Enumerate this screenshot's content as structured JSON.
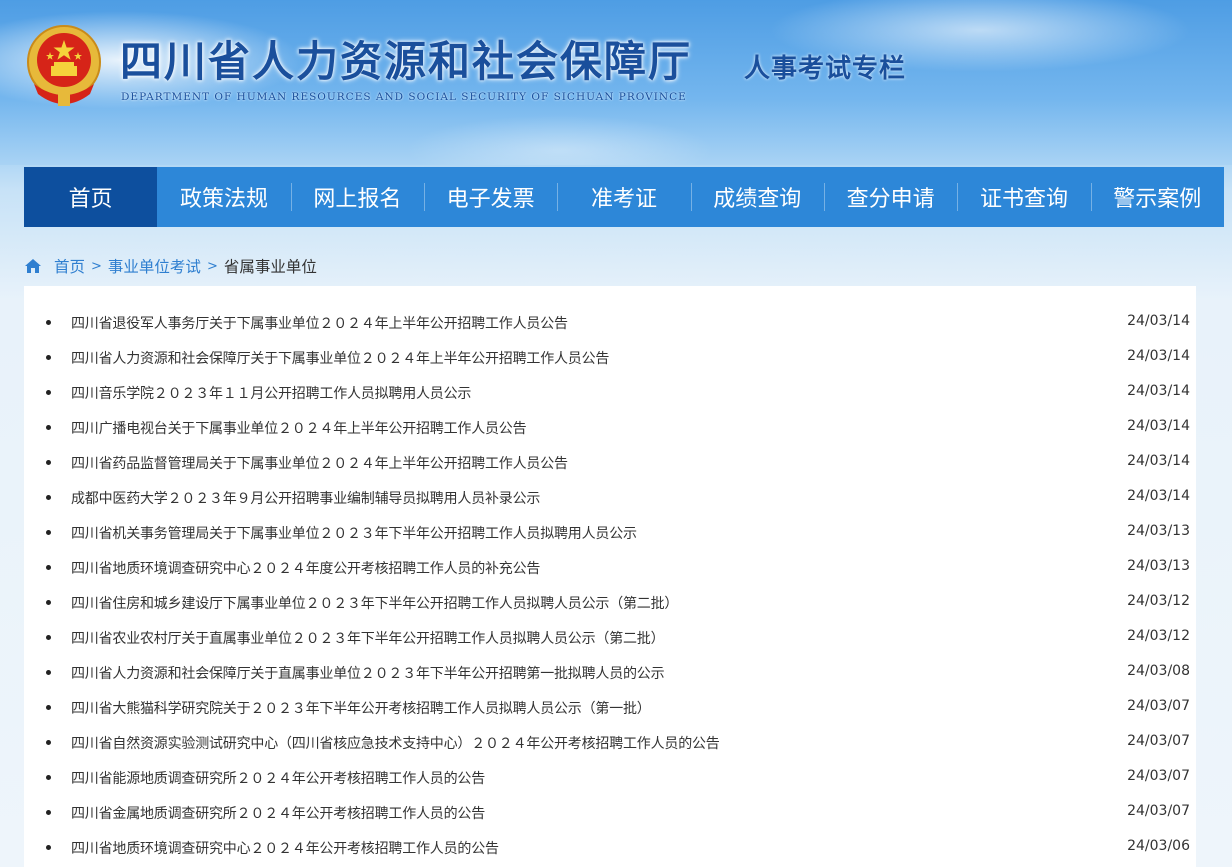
{
  "header": {
    "title": "四川省人力资源和社会保障厅",
    "subtitle": "DEPARTMENT OF HUMAN RESOURCES AND SOCIAL SECURITY OF SICHUAN PROVINCE",
    "column": "人事考试专栏",
    "emblem_icon": "national-emblem-icon"
  },
  "nav": {
    "items": [
      {
        "label": "首页",
        "active": true
      },
      {
        "label": "政策法规"
      },
      {
        "label": "网上报名"
      },
      {
        "label": "电子发票"
      },
      {
        "label": "准考证"
      },
      {
        "label": "成绩查询"
      },
      {
        "label": "查分申请"
      },
      {
        "label": "证书查询"
      },
      {
        "label": "警示案例"
      }
    ]
  },
  "breadcrumb": {
    "home": "首页",
    "level1": "事业单位考试",
    "current": "省属事业单位",
    "separator": ">"
  },
  "list": [
    {
      "title": "四川省退役军人事务厅关于下属事业单位２０２４年上半年公开招聘工作人员公告",
      "date": "24/03/14"
    },
    {
      "title": "四川省人力资源和社会保障厅关于下属事业单位２０２４年上半年公开招聘工作人员公告",
      "date": "24/03/14"
    },
    {
      "title": "四川音乐学院２０２３年１１月公开招聘工作人员拟聘用人员公示",
      "date": "24/03/14"
    },
    {
      "title": "四川广播电视台关于下属事业单位２０２４年上半年公开招聘工作人员公告",
      "date": "24/03/14"
    },
    {
      "title": "四川省药品监督管理局关于下属事业单位２０２４年上半年公开招聘工作人员公告",
      "date": "24/03/14"
    },
    {
      "title": "成都中医药大学２０２３年９月公开招聘事业编制辅导员拟聘用人员补录公示",
      "date": "24/03/14"
    },
    {
      "title": "四川省机关事务管理局关于下属事业单位２０２３年下半年公开招聘工作人员拟聘用人员公示",
      "date": "24/03/13"
    },
    {
      "title": "四川省地质环境调查研究中心２０２４年度公开考核招聘工作人员的补充公告",
      "date": "24/03/13"
    },
    {
      "title": "四川省住房和城乡建设厅下属事业单位２０２３年下半年公开招聘工作人员拟聘人员公示（第二批）",
      "date": "24/03/12"
    },
    {
      "title": "四川省农业农村厅关于直属事业单位２０２３年下半年公开招聘工作人员拟聘人员公示（第二批）",
      "date": "24/03/12"
    },
    {
      "title": "四川省人力资源和社会保障厅关于直属事业单位２０２３年下半年公开招聘第一批拟聘人员的公示",
      "date": "24/03/08"
    },
    {
      "title": "四川省大熊猫科学研究院关于２０２３年下半年公开考核招聘工作人员拟聘人员公示（第一批）",
      "date": "24/03/07"
    },
    {
      "title": "四川省自然资源实验测试研究中心（四川省核应急技术支持中心）２０２４年公开考核招聘工作人员的公告",
      "date": "24/03/07"
    },
    {
      "title": "四川省能源地质调查研究所２０２４年公开考核招聘工作人员的公告",
      "date": "24/03/07"
    },
    {
      "title": "四川省金属地质调查研究所２０２４年公开考核招聘工作人员的公告",
      "date": "24/03/07"
    },
    {
      "title": "四川省地质环境调查研究中心２０２４年公开考核招聘工作人员的公告",
      "date": "24/03/06"
    }
  ],
  "colors": {
    "nav_bg": "#2d87d8",
    "nav_active": "#0d4f9e",
    "title_blue": "#1a4f9c",
    "link_blue": "#2f7fd0"
  }
}
